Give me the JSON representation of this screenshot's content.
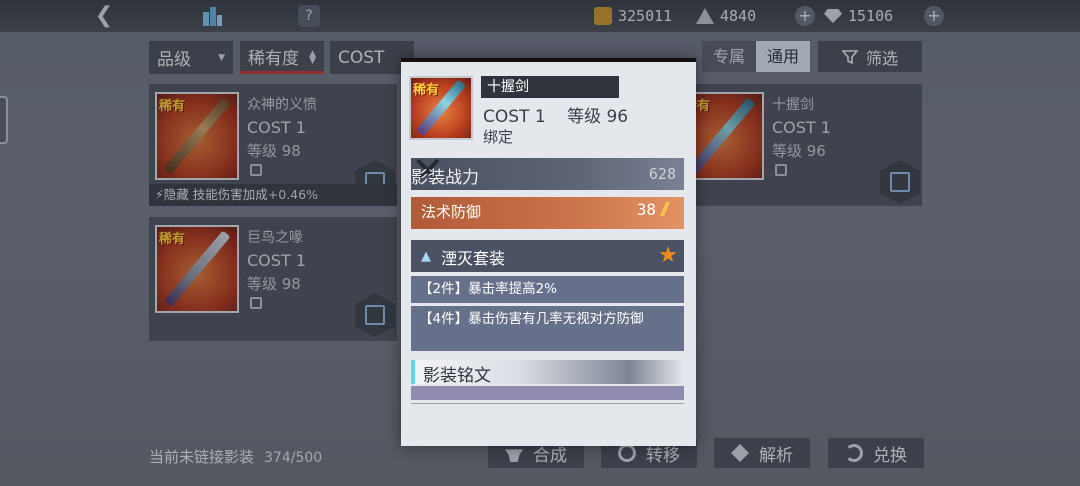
{
  "topbar": {
    "currencies": [
      {
        "icon": "gold-coin-icon",
        "value": "325011"
      },
      {
        "icon": "energy-triangle-icon",
        "value": "4840"
      },
      {
        "icon": "diamond-icon",
        "value": "15106"
      }
    ]
  },
  "filters": {
    "sort_rarity_grade": "品级",
    "sort_rarity": "稀有度",
    "sort_cost": "COST",
    "toggle_exclusive": "专属",
    "toggle_common": "通用",
    "filter_label": "筛选"
  },
  "cards": [
    {
      "rare": "稀有",
      "name": "众神的义愤",
      "cost": "COST 1",
      "level": "等级 98",
      "skill_prefix": "⚡隐藏",
      "skill_text": " 技能伤害加成",
      "skill_pct": "+0.46%"
    },
    {
      "rare": "稀有",
      "name": "巨鸟之喙",
      "cost": "COST 1",
      "level": "等级 98"
    },
    {
      "rare": "稀有",
      "name": "十握剑",
      "cost": "COST 1",
      "level": "等级 96"
    }
  ],
  "popup": {
    "rare": "稀有",
    "name": "十握剑",
    "cost_label": "COST",
    "cost_value": "1",
    "level_label": "等级",
    "level_value": "96",
    "bind": "绑定",
    "power_label": "影装战力",
    "power_value": "628",
    "stat_name": "法术防御",
    "stat_value": "38",
    "set_name": "湮灭套装",
    "set_bonus_2": "【2件】暴击率提高2%",
    "set_bonus_4": "【4件】暴击伤害有几率无视对方防御",
    "inscription_label": "影装铭文"
  },
  "bottom": {
    "unlinked_label": "当前未链接影装",
    "unlinked_count": "374/500",
    "actions": [
      "合成",
      "转移",
      "解析",
      "兑换"
    ]
  },
  "colors": {
    "accent_red": "#c33a3a",
    "rare_yellow": "#ffd23a",
    "star_orange": "#f08a1a",
    "stat_orange": "#c8714a"
  }
}
